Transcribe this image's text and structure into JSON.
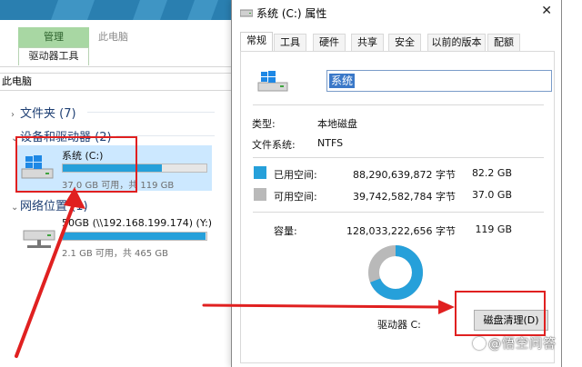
{
  "explorer": {
    "ribbon_tab_manage": "管理",
    "ribbon_tab_thispc": "此电脑",
    "ribbon_tab_drive_tools": "驱动器工具",
    "address": "此电脑",
    "groups": {
      "folders": "文件夹 (7)",
      "devices": "设备和驱动器 (2)",
      "network": "网络位置 (1)"
    },
    "drives": [
      {
        "name": "系统 (C:)",
        "sub": "37.0 GB 可用，共 119 GB",
        "used_fraction": 0.69
      },
      {
        "name": "50GB (\\\\192.168.199.174) (Y:)",
        "sub": "2.1 GB 可用，共 465 GB",
        "used_fraction": 0.995
      }
    ]
  },
  "dialog": {
    "title": "系统 (C:) 属性",
    "close_glyph": "✕",
    "tabs": [
      "常规",
      "工具",
      "硬件",
      "共享",
      "安全",
      "以前的版本",
      "配额"
    ],
    "active_tab": 0,
    "name_value": "系统",
    "type_label": "类型:",
    "type_value": "本地磁盘",
    "fs_label": "文件系统:",
    "fs_value": "NTFS",
    "used_label": "已用空间:",
    "used_bytes": "88,290,639,872 字节",
    "used_size": "82.2 GB",
    "free_label": "可用空间:",
    "free_bytes": "39,742,582,784 字节",
    "free_size": "37.0 GB",
    "capacity_label": "容量:",
    "capacity_bytes": "128,033,222,656 字节",
    "capacity_size": "119 GB",
    "drive_label": "驱动器 C:",
    "cleanup_button": "磁盘清理(D)",
    "used_fraction": 0.69
  },
  "colors": {
    "used": "#26a0da",
    "free": "#b9b9b9",
    "annotation": "#e02020"
  },
  "watermark": "@悟空问答"
}
